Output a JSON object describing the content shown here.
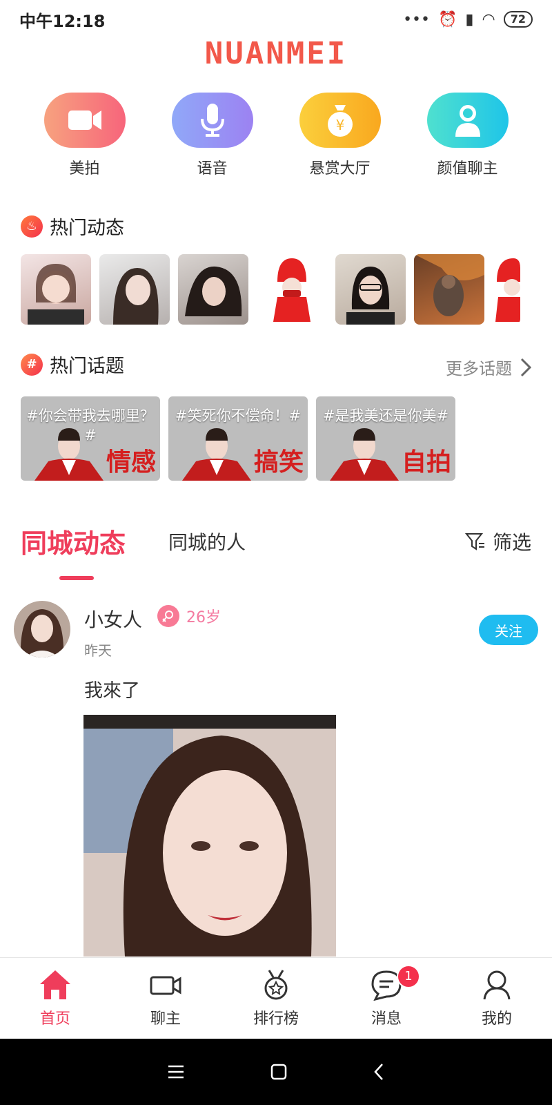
{
  "status_bar": {
    "time": "中午12:18",
    "battery": "72"
  },
  "brand": "NUANMEI",
  "quick_entries": [
    {
      "label": "美拍",
      "color": "#f77f7b"
    },
    {
      "label": "语音",
      "color": "#8aa3f7"
    },
    {
      "label": "悬赏大厅",
      "color": "#f9b62a"
    },
    {
      "label": "颜值聊主",
      "color": "#34d3d9"
    }
  ],
  "hot_feeds": {
    "title": "热门动态"
  },
  "hot_topics": {
    "title": "热门话题",
    "more": "更多话题",
    "topics": [
      {
        "text": "#你会带我去哪里？#",
        "tag": "情感"
      },
      {
        "text": "#笑死你不偿命！#",
        "tag": "搞笑"
      },
      {
        "text": "#是我美还是你美#",
        "tag": "自拍"
      }
    ]
  },
  "tabs": {
    "active": "同城动态",
    "other": "同城的人",
    "filter": "筛选"
  },
  "post": {
    "name": "小女人",
    "age": "26岁",
    "time": "昨天",
    "follow": "关注",
    "text": "我來了"
  },
  "bottom_nav": [
    {
      "label": "首页",
      "icon": "home-icon",
      "active": true
    },
    {
      "label": "聊主",
      "icon": "video-camera-icon"
    },
    {
      "label": "排行榜",
      "icon": "medal-icon"
    },
    {
      "label": "消息",
      "icon": "message-icon",
      "badge": "1"
    },
    {
      "label": "我的",
      "icon": "profile-icon"
    }
  ],
  "colors": {
    "accent": "#ef3d5b",
    "follow": "#1fbcf0"
  }
}
